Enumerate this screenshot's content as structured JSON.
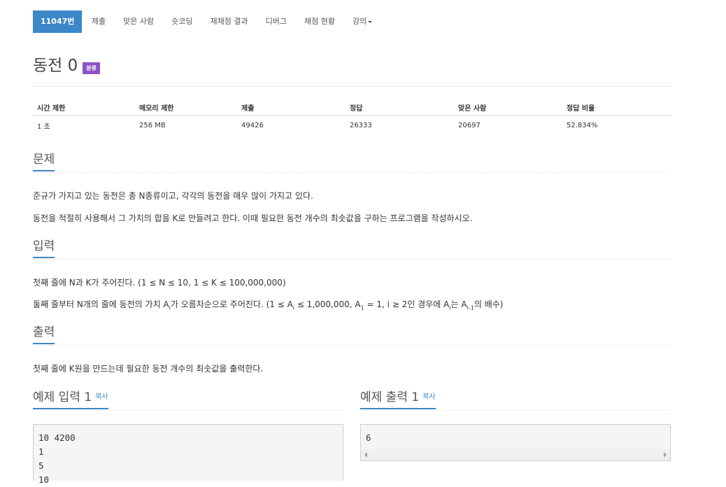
{
  "nav": {
    "items": [
      {
        "label": "11047번"
      },
      {
        "label": "제출"
      },
      {
        "label": "맞은 사람"
      },
      {
        "label": "숏코딩"
      },
      {
        "label": "재채점 결과"
      },
      {
        "label": "디버그"
      },
      {
        "label": "채점 현황"
      },
      {
        "label": "강의"
      }
    ]
  },
  "problem": {
    "title": "동전 0",
    "badge": "분류"
  },
  "info": {
    "headers": [
      "시간 제한",
      "메모리 제한",
      "제출",
      "정답",
      "맞은 사람",
      "정답 비율"
    ],
    "values": [
      "1 초",
      "256 MB",
      "49426",
      "26333",
      "20697",
      "52.834%"
    ]
  },
  "sections": {
    "problem": {
      "heading": "문제",
      "lines": [
        "준규가 가지고 있는 동전은 총 N종류이고, 각각의 동전을 매우 많이 가지고 있다.",
        "동전을 적절히 사용해서 그 가치의 합을 K로 만들려고 한다. 이때 필요한 동전 개수의 최솟값을 구하는 프로그램을 작성하시오."
      ]
    },
    "input": {
      "heading": "입력",
      "line1": "첫째 줄에 N과 K가 주어진다. (1 ≤ N ≤ 10, 1 ≤ K ≤ 100,000,000)",
      "line2": {
        "p1": "둘째 줄부터 N개의 줄에 동전의 가치 A",
        "s1": "i",
        "p2": "가 오름차순으로 주어진다. (1 ≤ A",
        "s2": "i",
        "p3": " ≤ 1,000,000, A",
        "s3": "1",
        "p4": " = 1, i ≥ 2인 경우에 A",
        "s4": "i",
        "p5": "는 A",
        "s5": "i-1",
        "p6": "의 배수)"
      }
    },
    "output": {
      "heading": "출력",
      "line": "첫째 줄에 K원을 만드는데 필요한 동전 개수의 최솟값을 출력한다."
    }
  },
  "samples": {
    "input_heading": "예제 입력 1",
    "output_heading": "예제 출력 1",
    "copy_label": "복사",
    "input_text": "10 4200\n1\n5\n10",
    "output_text": "6"
  }
}
